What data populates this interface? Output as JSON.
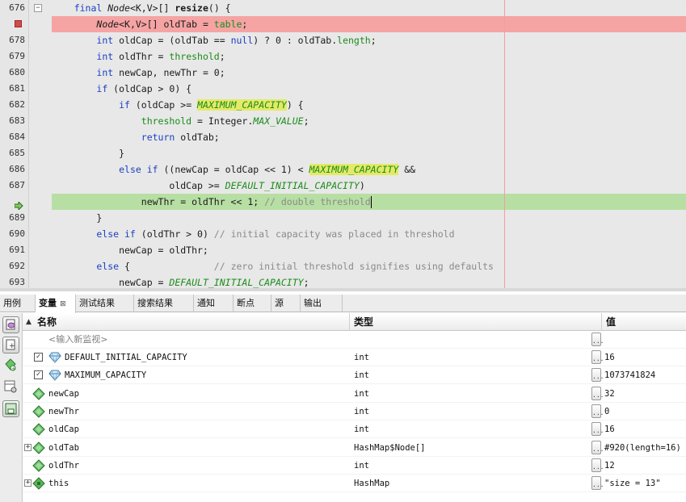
{
  "editor": {
    "lines": [
      {
        "num": "676",
        "fold": "−",
        "segments": [
          {
            "t": "    "
          },
          {
            "t": "final ",
            "c": "kw"
          },
          {
            "t": "Node",
            "c": "ital"
          },
          {
            "t": "<K,V>[] "
          },
          {
            "t": "resize",
            "c": "bold"
          },
          {
            "t": "() {"
          }
        ]
      },
      {
        "num": "",
        "mark": "breakpoint",
        "segments": [
          {
            "t": "        "
          },
          {
            "t": "Node",
            "c": "ital"
          },
          {
            "t": "<K,V>[] oldTab = "
          },
          {
            "t": "table",
            "c": "fld"
          },
          {
            "t": ";"
          }
        ]
      },
      {
        "num": "678",
        "segments": [
          {
            "t": "        "
          },
          {
            "t": "int",
            "c": "kw"
          },
          {
            "t": " oldCap = (oldTab == "
          },
          {
            "t": "null",
            "c": "kw"
          },
          {
            "t": ") ? 0 : oldTab."
          },
          {
            "t": "length",
            "c": "fld"
          },
          {
            "t": ";"
          }
        ]
      },
      {
        "num": "679",
        "segments": [
          {
            "t": "        "
          },
          {
            "t": "int",
            "c": "kw"
          },
          {
            "t": " oldThr = "
          },
          {
            "t": "threshold",
            "c": "fld"
          },
          {
            "t": ";"
          }
        ]
      },
      {
        "num": "680",
        "segments": [
          {
            "t": "        "
          },
          {
            "t": "int",
            "c": "kw"
          },
          {
            "t": " newCap, newThr = 0;"
          }
        ]
      },
      {
        "num": "681",
        "segments": [
          {
            "t": "        "
          },
          {
            "t": "if",
            "c": "kw"
          },
          {
            "t": " (oldCap > 0) {"
          }
        ]
      },
      {
        "num": "682",
        "segments": [
          {
            "t": "            "
          },
          {
            "t": "if",
            "c": "kw"
          },
          {
            "t": " (oldCap >= "
          },
          {
            "t": "MAXIMUM_CAPACITY",
            "c": "sfi hl"
          },
          {
            "t": ") {"
          }
        ]
      },
      {
        "num": "683",
        "segments": [
          {
            "t": "                "
          },
          {
            "t": "threshold",
            "c": "fld"
          },
          {
            "t": " = Integer."
          },
          {
            "t": "MAX_VALUE",
            "c": "sfi"
          },
          {
            "t": ";"
          }
        ]
      },
      {
        "num": "684",
        "segments": [
          {
            "t": "                "
          },
          {
            "t": "return",
            "c": "kw"
          },
          {
            "t": " oldTab;"
          }
        ]
      },
      {
        "num": "685",
        "segments": [
          {
            "t": "            }"
          }
        ]
      },
      {
        "num": "686",
        "segments": [
          {
            "t": "            "
          },
          {
            "t": "else if",
            "c": "kw"
          },
          {
            "t": " ((newCap = oldCap << 1) < "
          },
          {
            "t": "MAXIMUM_CAPACITY",
            "c": "sfi hl"
          },
          {
            "t": " &&"
          }
        ]
      },
      {
        "num": "687",
        "segments": [
          {
            "t": "                     oldCap >= "
          },
          {
            "t": "DEFAULT_INITIAL_CAPACITY",
            "c": "sfi"
          },
          {
            "t": ")"
          }
        ]
      },
      {
        "num": "",
        "mark": "program-counter",
        "segments": [
          {
            "t": "                newThr = oldThr << 1; "
          },
          {
            "t": "// double threshold",
            "c": "cmt"
          },
          {
            "t": "",
            "caret": true
          }
        ]
      },
      {
        "num": "689",
        "segments": [
          {
            "t": "        }"
          }
        ]
      },
      {
        "num": "690",
        "segments": [
          {
            "t": "        "
          },
          {
            "t": "else if",
            "c": "kw"
          },
          {
            "t": " (oldThr > 0) "
          },
          {
            "t": "// initial capacity was placed in threshold",
            "c": "cmt"
          }
        ]
      },
      {
        "num": "691",
        "segments": [
          {
            "t": "            newCap = oldThr;"
          }
        ]
      },
      {
        "num": "692",
        "segments": [
          {
            "t": "        "
          },
          {
            "t": "else",
            "c": "kw"
          },
          {
            "t": " {               "
          },
          {
            "t": "// zero initial threshold signifies using defaults",
            "c": "cmt"
          }
        ]
      },
      {
        "num": "693",
        "segments": [
          {
            "t": "            newCap = "
          },
          {
            "t": "DEFAULT_INITIAL_CAPACITY",
            "c": "sfi"
          },
          {
            "t": ";"
          }
        ]
      }
    ]
  },
  "panel": {
    "tabs": [
      {
        "label": "用例",
        "name": "tab-usages"
      },
      {
        "label": "变量",
        "name": "tab-variables",
        "active": true,
        "close": "⊠"
      },
      {
        "label": "测试结果",
        "name": "tab-test-results"
      },
      {
        "label": "搜索结果",
        "name": "tab-search-results"
      },
      {
        "label": "通知",
        "name": "tab-notifications"
      },
      {
        "label": "断点",
        "name": "tab-breakpoints"
      },
      {
        "label": "源",
        "name": "tab-sources"
      },
      {
        "label": "输出",
        "name": "tab-output"
      }
    ],
    "columns": {
      "name": "名称",
      "type": "类型",
      "value": "值"
    },
    "new_watch_placeholder": "<输入新监视>",
    "rows": [
      {
        "name": "DEFAULT_INITIAL_CAPACITY",
        "type": "int",
        "value": "16",
        "checkbox": true,
        "icon": "static-field-icon"
      },
      {
        "name": "MAXIMUM_CAPACITY",
        "type": "int",
        "value": "1073741824",
        "checkbox": true,
        "icon": "static-field-icon"
      },
      {
        "name": "newCap",
        "type": "int",
        "value": "32",
        "icon": "local-variable-icon"
      },
      {
        "name": "newThr",
        "type": "int",
        "value": "0",
        "icon": "local-variable-icon"
      },
      {
        "name": "oldCap",
        "type": "int",
        "value": "16",
        "icon": "local-variable-icon"
      },
      {
        "name": "oldTab",
        "type": "HashMap$Node[]",
        "value": "#920(length=16)",
        "expandable": true,
        "icon": "local-variable-icon"
      },
      {
        "name": "oldThr",
        "type": "int",
        "value": "12",
        "icon": "local-variable-icon"
      },
      {
        "name": "this",
        "type": "HashMap",
        "value": "\"size = 13\"",
        "expandable": true,
        "icon": "this-object-icon"
      }
    ],
    "ellipsis": "...",
    "expander": "+",
    "check": "✓"
  },
  "colors": {
    "breakpoint_line": "#f5a3a3",
    "current_line": "#b7dfa3",
    "keyword": "#1b3fc2",
    "field": "#1a8c1a",
    "highlight": "#e4ea66",
    "comment": "#8a8a8a",
    "variable_icon": "#4fb24f"
  }
}
